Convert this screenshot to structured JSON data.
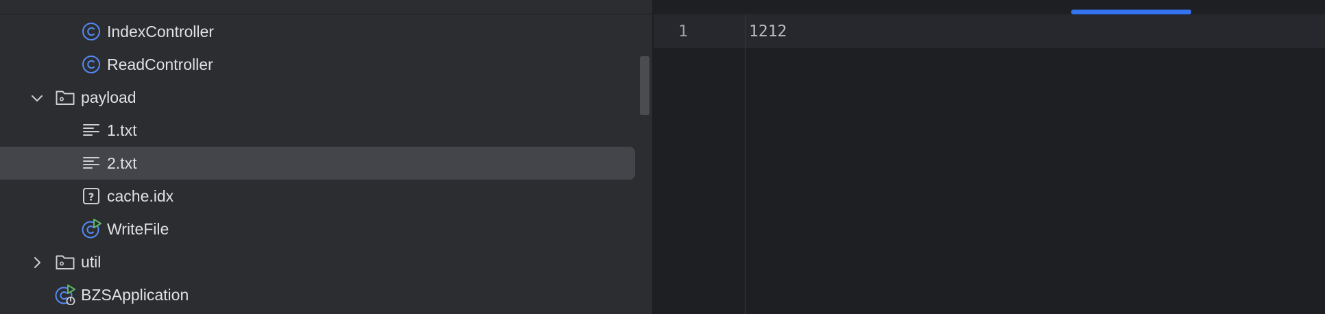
{
  "colors": {
    "class_icon": "#548af7",
    "run_badge": "#5fb865",
    "tab_accent": "#3574f0",
    "tree_bg": "#2b2d30",
    "editor_bg": "#1e1f22",
    "selection": "#43454a"
  },
  "project_tree": {
    "items": [
      {
        "label": "IndexController",
        "icon": "java-class-icon"
      },
      {
        "label": "ReadController",
        "icon": "java-class-icon"
      },
      {
        "label": "payload",
        "icon": "folder-icon",
        "expanded": true
      },
      {
        "label": "1.txt",
        "icon": "text-file-icon"
      },
      {
        "label": "2.txt",
        "icon": "text-file-icon",
        "selected": true
      },
      {
        "label": "cache.idx",
        "icon": "unknown-file-icon"
      },
      {
        "label": "WriteFile",
        "icon": "runnable-class-icon"
      },
      {
        "label": "util",
        "icon": "folder-icon",
        "expanded": false
      },
      {
        "label": "BZSApplication",
        "icon": "spring-boot-app-icon"
      }
    ]
  },
  "editor": {
    "lines": [
      {
        "number": "1",
        "text": "1212"
      }
    ]
  }
}
